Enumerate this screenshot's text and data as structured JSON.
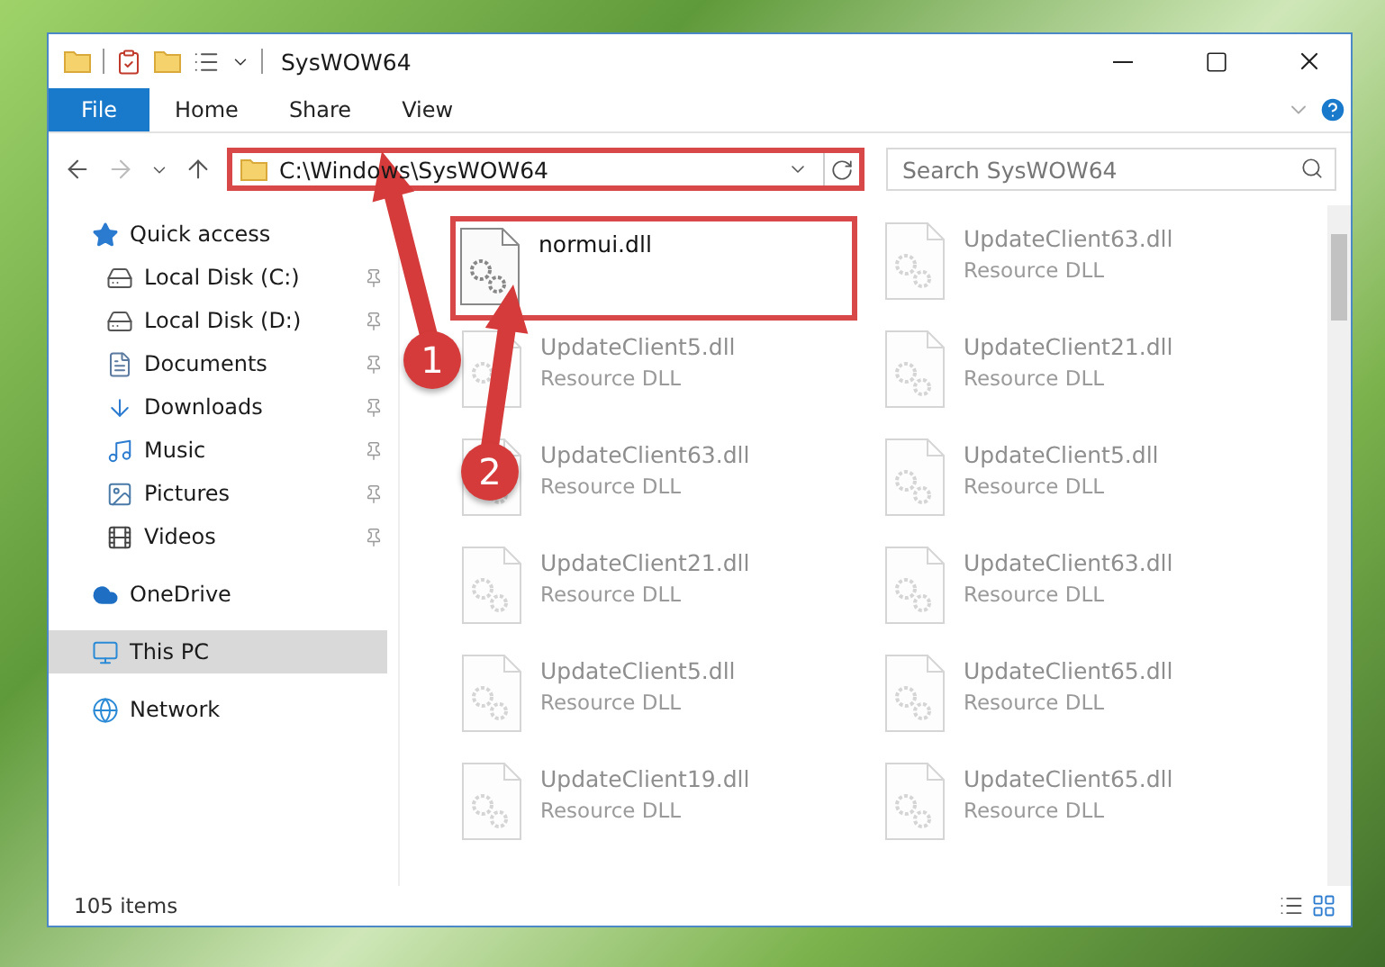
{
  "window": {
    "title": "SysWOW64"
  },
  "ribbon_tabs": [
    {
      "label": "File",
      "kind": "file"
    },
    {
      "label": "Home",
      "kind": "tab"
    },
    {
      "label": "Share",
      "kind": "tab"
    },
    {
      "label": "View",
      "kind": "tab"
    }
  ],
  "address_bar": {
    "path": "C:\\Windows\\SysWOW64",
    "highlighted": true
  },
  "search": {
    "placeholder": "Search SysWOW64"
  },
  "sidebar": {
    "items": [
      {
        "label": "Quick access",
        "kind": "star",
        "selected": false,
        "children": [
          {
            "label": "Local Disk (C:)",
            "kind": "system-drive",
            "pinned": true
          },
          {
            "label": "Local Disk (D:)",
            "kind": "drive",
            "pinned": true
          },
          {
            "label": "Documents",
            "kind": "documents",
            "pinned": true
          },
          {
            "label": "Downloads",
            "kind": "downloads",
            "pinned": true
          },
          {
            "label": "Music",
            "kind": "music",
            "pinned": true
          },
          {
            "label": "Pictures",
            "kind": "pictures",
            "pinned": true
          },
          {
            "label": "Videos",
            "kind": "videos",
            "pinned": true
          }
        ]
      },
      {
        "label": "OneDrive",
        "kind": "cloud",
        "selected": false
      },
      {
        "label": "This PC",
        "kind": "pc",
        "selected": true
      },
      {
        "label": "Network",
        "kind": "network",
        "selected": false
      }
    ]
  },
  "files": [
    {
      "name": "normui.dll",
      "highlighted": true,
      "faded": false
    },
    {
      "name": "UpdateClient63.dll",
      "type": "Resource DLL",
      "highlighted": false,
      "faded": true
    },
    {
      "name": "UpdateClient5.dll",
      "type": "Resource DLL",
      "highlighted": false,
      "faded": true
    },
    {
      "name": "UpdateClient21.dll",
      "type": "Resource DLL",
      "highlighted": false,
      "faded": true
    },
    {
      "name": "UpdateClient63.dll",
      "type": "Resource DLL",
      "highlighted": false,
      "faded": true
    },
    {
      "name": "UpdateClient5.dll",
      "type": "Resource DLL",
      "highlighted": false,
      "faded": true
    },
    {
      "name": "UpdateClient21.dll",
      "type": "Resource DLL",
      "highlighted": false,
      "faded": true
    },
    {
      "name": "UpdateClient63.dll",
      "type": "Resource DLL",
      "highlighted": false,
      "faded": true
    },
    {
      "name": "UpdateClient5.dll",
      "type": "Resource DLL",
      "highlighted": false,
      "faded": true
    },
    {
      "name": "UpdateClient65.dll",
      "type": "Resource DLL",
      "highlighted": false,
      "faded": true
    },
    {
      "name": "UpdateClient19.dll",
      "type": "Resource DLL",
      "highlighted": false,
      "faded": true
    },
    {
      "name": "UpdateClient65.dll",
      "type": "Resource DLL",
      "highlighted": false,
      "faded": true
    }
  ],
  "status_bar": {
    "item_count": "105 items"
  },
  "annotations": [
    {
      "label": "1"
    },
    {
      "label": "2"
    }
  ]
}
